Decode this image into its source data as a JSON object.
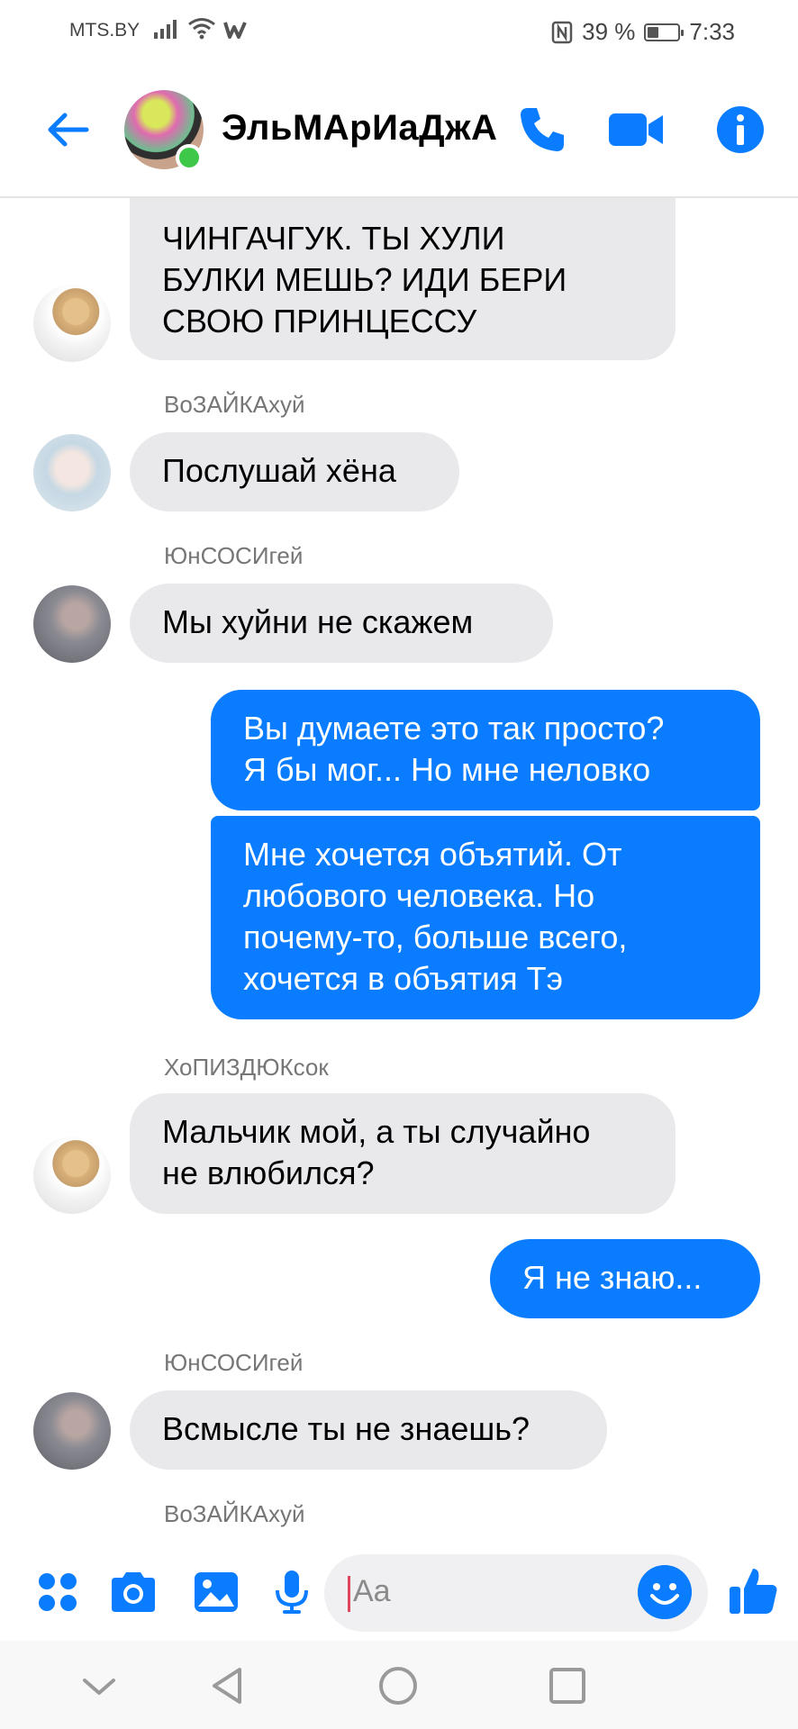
{
  "status_bar": {
    "carrier": "MTS.BY",
    "battery_percent": "39 %",
    "battery_level": 0.39,
    "time": "7:33"
  },
  "header": {
    "title": "ЭльМАрИаДжА",
    "icons": [
      "back-arrow-icon",
      "phone-icon",
      "video-camera-icon",
      "info-icon"
    ]
  },
  "messages": [
    {
      "direction": "in",
      "sender": "",
      "lines": [
        "ЧИНГАЧГУК. ТЫ ХУЛИ",
        "БУЛКИ МЕШЬ? ИДИ БЕРИ",
        "СВОЮ ПРИНЦЕССУ"
      ]
    },
    {
      "direction": "in",
      "sender": "ВоЗАЙКАхуй",
      "lines": [
        "Послушай хёна"
      ]
    },
    {
      "direction": "in",
      "sender": "ЮнСОСИгей",
      "lines": [
        "Мы хуйни не скажем"
      ]
    },
    {
      "direction": "out",
      "sender": "",
      "lines": [
        "Вы думаете это так просто?",
        "Я бы мог... Но мне неловко"
      ]
    },
    {
      "direction": "out",
      "sender": "",
      "lines": [
        "Мне хочется объятий. От",
        "любового человека. Но",
        "почему-то, больше всего,",
        "хочется в объятия Тэ"
      ]
    },
    {
      "direction": "in",
      "sender": "ХоПИЗДЮКсок",
      "lines": [
        "Мальчик мой, а ты случайно",
        "не влюбился?"
      ]
    },
    {
      "direction": "out",
      "sender": "",
      "lines": [
        "Я не знаю..."
      ]
    },
    {
      "direction": "in",
      "sender": "ЮнСОСИгей",
      "lines": [
        "Всмысле ты не знаешь?"
      ]
    },
    {
      "direction": "in",
      "sender": "ВоЗАЙКАхуй",
      "lines": []
    }
  ],
  "composer": {
    "placeholder": "Aa",
    "icons": [
      "menu-dots-icon",
      "camera-icon",
      "gallery-icon",
      "microphone-icon",
      "emoji-icon",
      "thumbs-up-icon"
    ]
  },
  "nav_bar": {
    "icons": [
      "collapse-chevron-icon",
      "back-triangle-icon",
      "home-circle-icon",
      "recents-square-icon"
    ]
  },
  "colors": {
    "accent": "#0a7cff",
    "incoming_bubble": "#e9e9ec",
    "online": "#3ec84a"
  }
}
